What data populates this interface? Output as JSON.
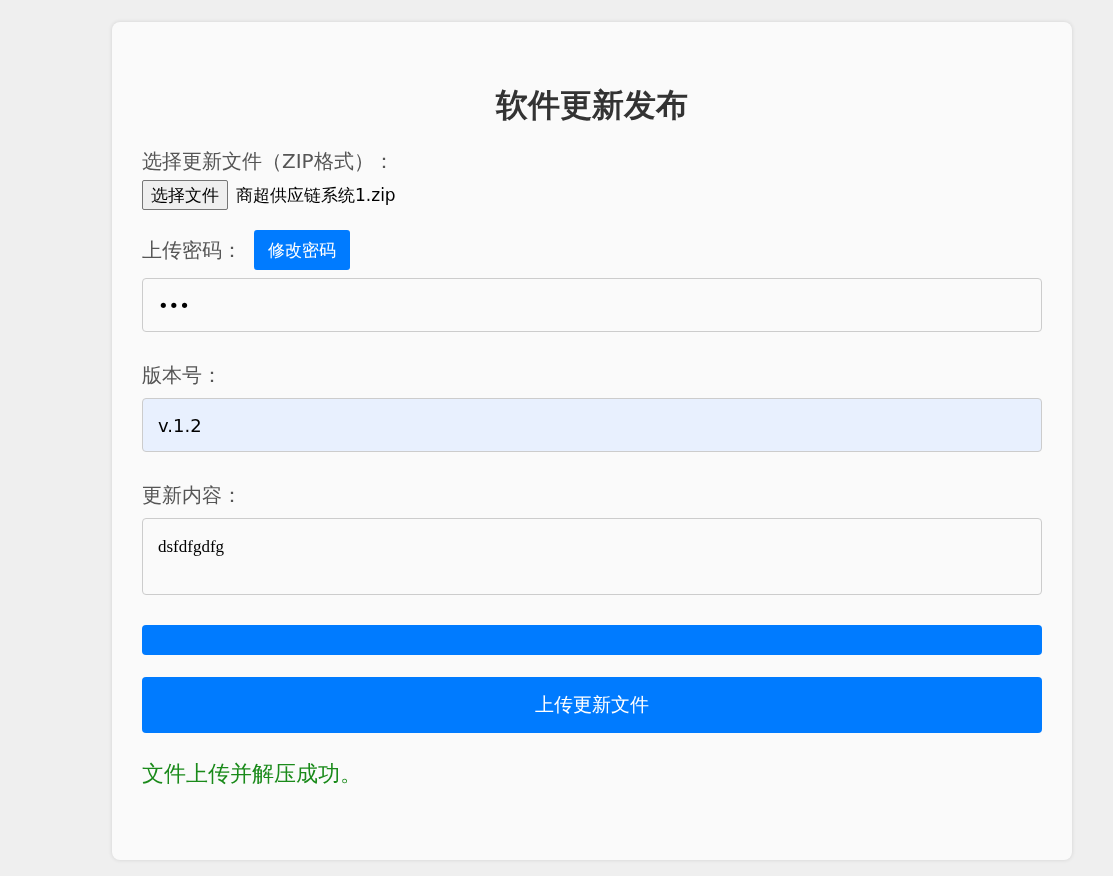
{
  "title": "软件更新发布",
  "file": {
    "label": "选择更新文件（ZIP格式）：",
    "button": "选择文件",
    "filename": "商超供应链系统1.zip"
  },
  "password": {
    "label": "上传密码：",
    "change_button": "修改密码",
    "value": "•••"
  },
  "version": {
    "label": "版本号：",
    "value": "v.1.2",
    "autofilled": true
  },
  "notes": {
    "label": "更新内容：",
    "value": "dsfdfgdfg"
  },
  "progress": {
    "level": 1
  },
  "submit": "上传更新文件",
  "status": {
    "text": "文件上传并解压成功。",
    "kind": "success"
  }
}
